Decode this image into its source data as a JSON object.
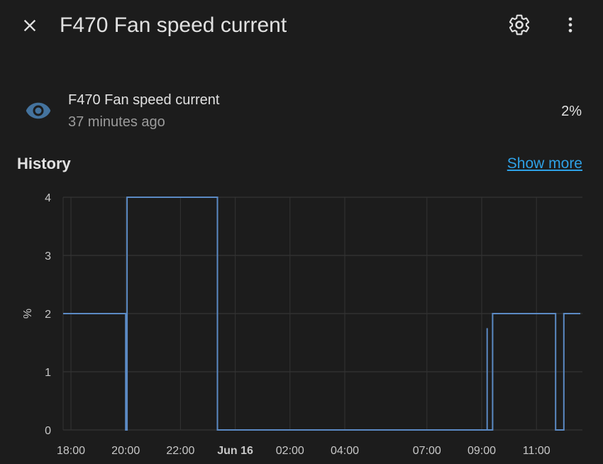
{
  "header": {
    "title": "F470 Fan speed current",
    "close_icon": "close-icon",
    "settings_icon": "gear-icon",
    "menu_icon": "more-vertical-icon"
  },
  "entity": {
    "icon": "eye-icon",
    "name": "F470 Fan speed current",
    "last_changed": "37 minutes ago",
    "state": "2%"
  },
  "history": {
    "title": "History",
    "show_more_label": "Show more"
  },
  "colors": {
    "background": "#1c1c1c",
    "accent_link": "#2ea1e6",
    "line": "#5b8ac4",
    "icon_primary": "#44739e"
  },
  "chart_data": {
    "type": "line",
    "step": true,
    "ylabel": "%",
    "ylim": [
      0,
      4
    ],
    "y_ticks": [
      "0",
      "1",
      "2",
      "3",
      "4"
    ],
    "x_ticks": [
      {
        "label": "18:00",
        "h": 0,
        "bold": false
      },
      {
        "label": "20:00",
        "h": 2,
        "bold": false
      },
      {
        "label": "22:00",
        "h": 4,
        "bold": false
      },
      {
        "label": "Jun 16",
        "h": 6,
        "bold": true
      },
      {
        "label": "02:00",
        "h": 8,
        "bold": false
      },
      {
        "label": "04:00",
        "h": 10,
        "bold": false
      },
      {
        "label": "07:00",
        "h": 13,
        "bold": false
      },
      {
        "label": "09:00",
        "h": 15,
        "bold": false
      },
      {
        "label": "11:00",
        "h": 17,
        "bold": false
      }
    ],
    "x_unit": "hours since 18:00",
    "x_range": [
      -0.3,
      18.6
    ],
    "grid": true,
    "series": [
      {
        "name": "",
        "points": [
          [
            -0.3,
            2
          ],
          [
            2.0,
            2
          ],
          [
            2.0,
            0
          ],
          [
            2.05,
            0
          ],
          [
            2.05,
            4
          ],
          [
            5.35,
            4
          ],
          [
            5.35,
            0
          ],
          [
            15.2,
            0
          ],
          [
            15.2,
            1.75
          ],
          [
            15.2,
            0
          ],
          [
            15.4,
            0
          ],
          [
            15.4,
            2
          ],
          [
            17.7,
            2
          ],
          [
            17.7,
            0
          ],
          [
            18.0,
            0
          ],
          [
            18.0,
            2
          ],
          [
            18.6,
            2
          ]
        ]
      }
    ]
  }
}
